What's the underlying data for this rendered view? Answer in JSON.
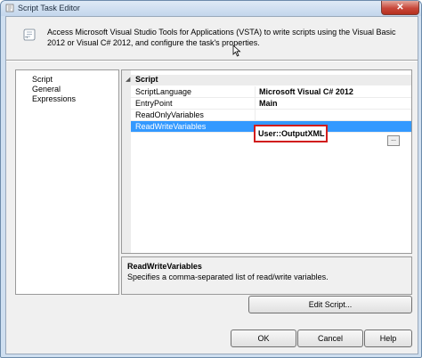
{
  "window": {
    "title": "Script Task Editor",
    "close_glyph": "✕"
  },
  "header": {
    "description": "Access Microsoft Visual Studio Tools for Applications (VSTA) to write scripts using the Visual Basic 2012 or Visual C# 2012, and configure the task's properties.",
    "icon": "script-scroll-icon"
  },
  "nav": {
    "items": [
      "Script",
      "General",
      "Expressions"
    ]
  },
  "grid": {
    "category": "Script",
    "category_glyph": "◢",
    "properties": [
      {
        "name": "ScriptLanguage",
        "value": "Microsoft Visual C# 2012"
      },
      {
        "name": "EntryPoint",
        "value": "Main"
      },
      {
        "name": "ReadOnlyVariables",
        "value": ""
      },
      {
        "name": "ReadWriteVariables",
        "value": "User::OutputXML"
      }
    ],
    "ellipsis": "...",
    "selected_color": "#3399ff",
    "highlight_color": "#d11d1d"
  },
  "description_panel": {
    "title": "ReadWriteVariables",
    "text": "Specifies a comma-separated list of read/write variables."
  },
  "buttons": {
    "edit_script": "Edit Script...",
    "ok": "OK",
    "cancel": "Cancel",
    "help": "Help"
  }
}
